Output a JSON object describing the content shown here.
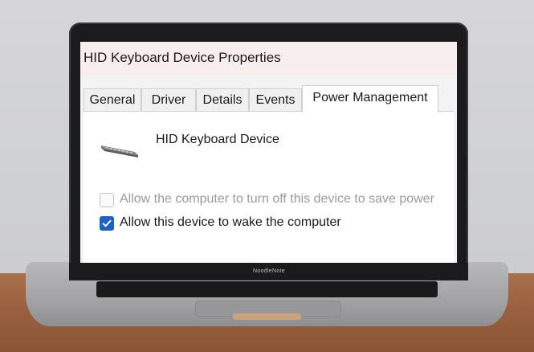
{
  "window": {
    "title": "HID Keyboard Device Properties"
  },
  "tabs": [
    {
      "label": "General",
      "active": false
    },
    {
      "label": "Driver",
      "active": false
    },
    {
      "label": "Details",
      "active": false
    },
    {
      "label": "Events",
      "active": false
    },
    {
      "label": "Power Management",
      "active": true
    }
  ],
  "device": {
    "name": "HID Keyboard Device",
    "icon": "keyboard-icon"
  },
  "options": [
    {
      "label": "Allow the computer to turn off this device to save power",
      "checked": false,
      "enabled": false
    },
    {
      "label": "Allow this device to wake the computer",
      "checked": true,
      "enabled": true
    }
  ],
  "laptop": {
    "brand": "NoodleNote"
  },
  "colors": {
    "accent": "#1c62c4",
    "disabled_text": "#9b9b9b",
    "titlebar": "#f9eeee"
  }
}
